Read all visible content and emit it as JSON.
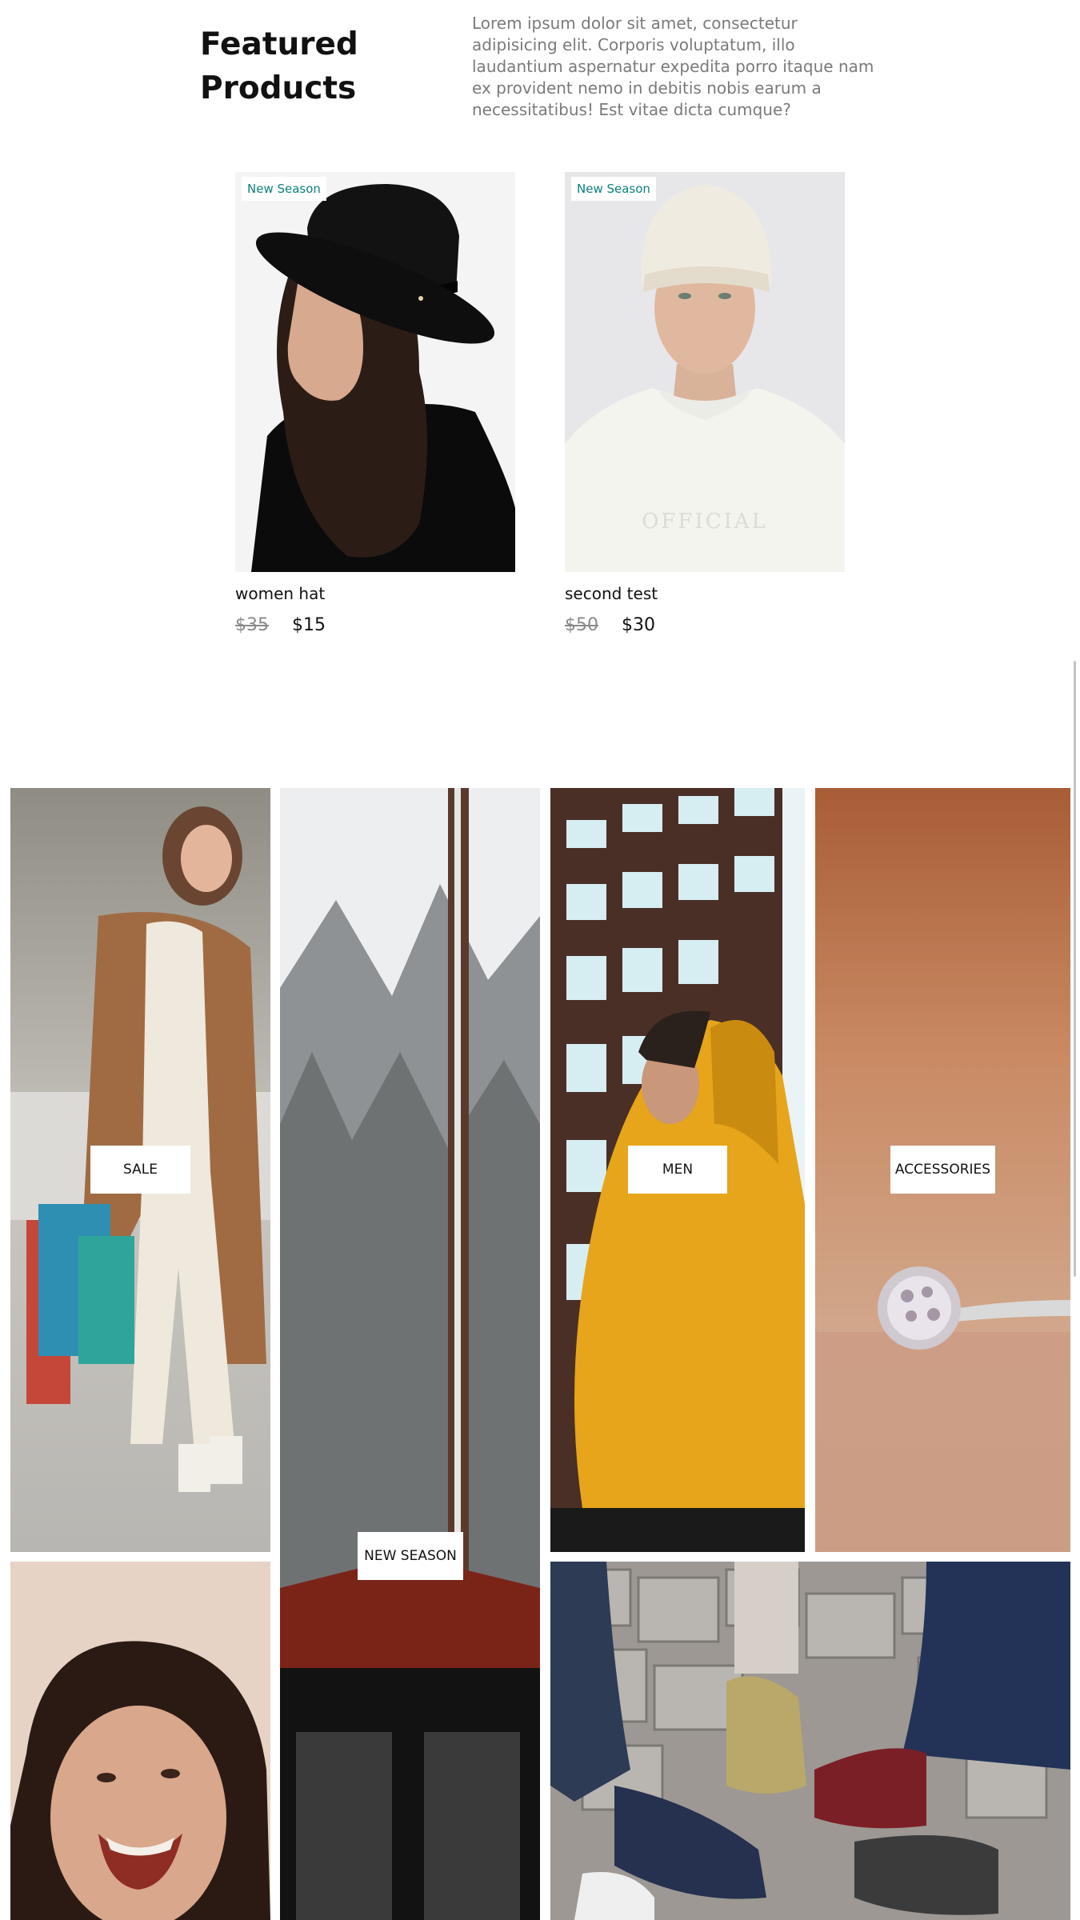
{
  "featured": {
    "title": "Featured Products",
    "description": "Lorem ipsum dolor sit amet, consectetur adipisicing elit. Corporis voluptatum, illo laudantium aspernatur expedita porro itaque nam ex provident nemo in debitis nobis earum a necessitatibus! Est vitae dicta cumque?"
  },
  "products": [
    {
      "badge": "New Season",
      "name": "women hat",
      "old_price": "$35",
      "price": "$15",
      "image": "woman-in-black-hat"
    },
    {
      "badge": "New Season",
      "name": "second test",
      "old_price": "$50",
      "price": "$30",
      "image": "man-in-white-beanie",
      "shirt_print": "OFFICIAL"
    }
  ],
  "categories": [
    {
      "label": "SALE",
      "image": "woman-with-shopping-bags"
    },
    {
      "label": "NEW SEASON",
      "image": "snowy-forest-cabin"
    },
    {
      "label": "MEN",
      "image": "man-in-yellow-hoodie"
    },
    {
      "label": "ACCESSORIES",
      "image": "diamond-ring"
    },
    {
      "label": "",
      "image": "laughing-woman"
    },
    {
      "label": "",
      "image": "sneakers-on-cobblestone"
    }
  ],
  "colors": {
    "badge_text": "#0d7f7f",
    "description_text": "#7a7a7a",
    "old_price": "#8a8a8a"
  }
}
